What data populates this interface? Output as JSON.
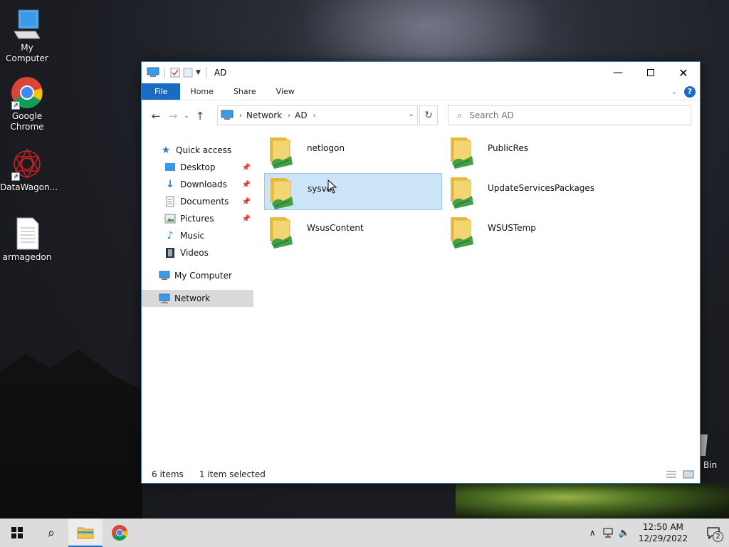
{
  "desktop": {
    "icons": [
      {
        "label": "My Computer"
      },
      {
        "label": "Google Chrome"
      },
      {
        "label": "DataWagon..."
      },
      {
        "label": "armagedon"
      }
    ],
    "recycle_label": "Bin"
  },
  "window": {
    "title": "AD",
    "ribbon_tabs": [
      "File",
      "Home",
      "Share",
      "View"
    ],
    "address": {
      "crumbs": [
        "Network",
        "AD"
      ]
    },
    "search": {
      "placeholder": "Search AD"
    },
    "nav": {
      "quick_access": "Quick access",
      "items": [
        {
          "label": "Desktop",
          "pinned": true
        },
        {
          "label": "Downloads",
          "pinned": true
        },
        {
          "label": "Documents",
          "pinned": true
        },
        {
          "label": "Pictures",
          "pinned": true
        },
        {
          "label": "Music",
          "pinned": false
        },
        {
          "label": "Videos",
          "pinned": false
        }
      ],
      "my_computer": "My Computer",
      "network": "Network"
    },
    "folders": [
      {
        "name": "netlogon",
        "selected": false
      },
      {
        "name": "PublicRes",
        "selected": false
      },
      {
        "name": "sysvol",
        "selected": true
      },
      {
        "name": "UpdateServicesPackages",
        "selected": false
      },
      {
        "name": "WsusContent",
        "selected": false
      },
      {
        "name": "WSUSTemp",
        "selected": false
      }
    ],
    "status": {
      "count": "6 items",
      "selection": "1 item selected"
    }
  },
  "taskbar": {
    "time": "12:50 AM",
    "date": "12/29/2022",
    "notifications": "2"
  },
  "colors": {
    "accent": "#1a6bc4",
    "selection": "#cce4f7",
    "folder": "#f3d672"
  }
}
